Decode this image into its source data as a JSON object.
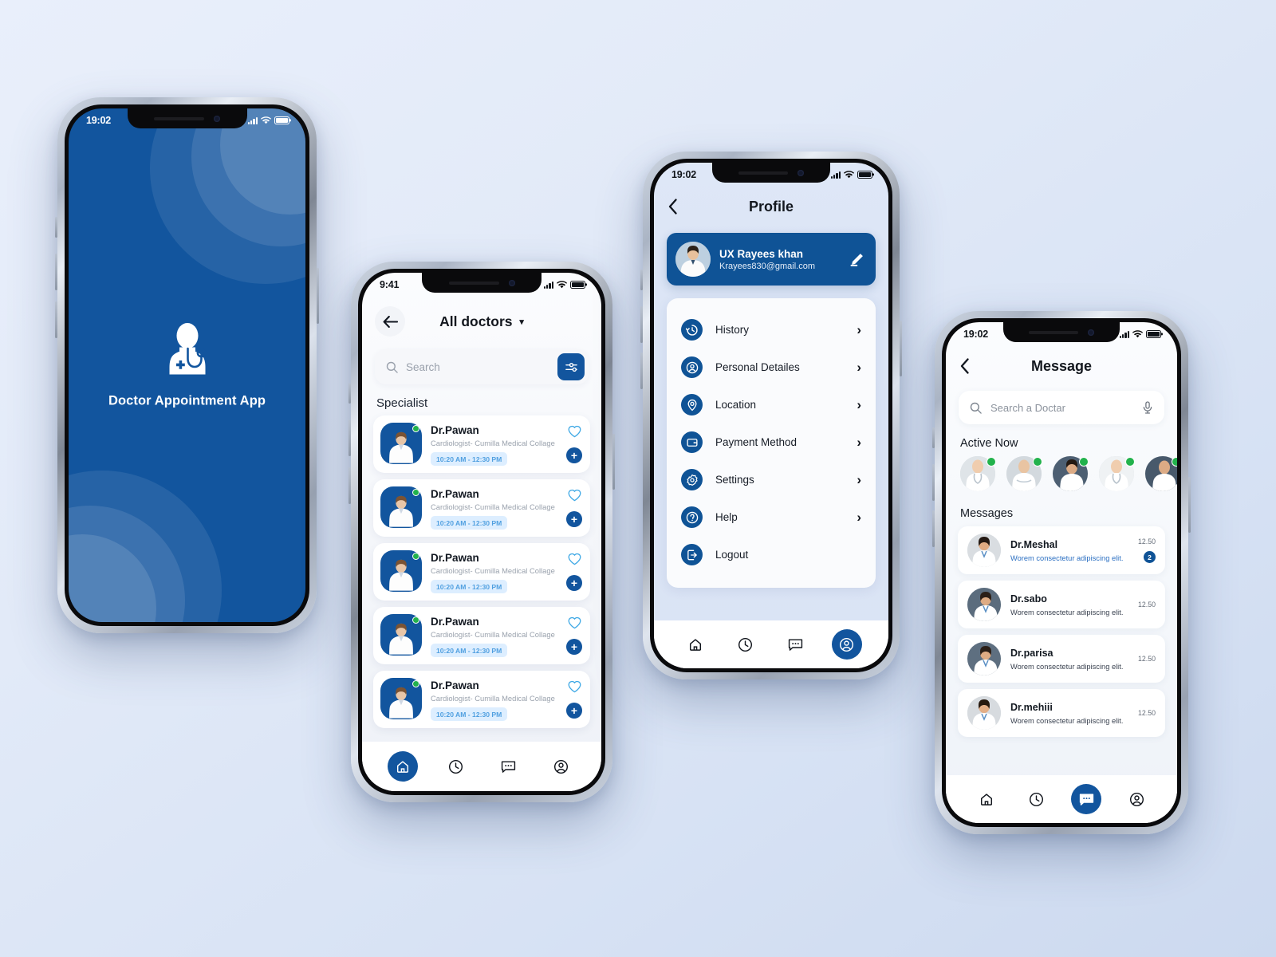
{
  "theme": {
    "primary": "#12559e",
    "primary_dark": "#0f5396",
    "accent_chip_bg": "#ddeeff",
    "accent_chip_text": "#4f9fe0",
    "online": "#22b24c",
    "page_bg": "#e2eaf8"
  },
  "splash": {
    "status": {
      "time": "19:02"
    },
    "icon": "doctor-icon",
    "title": "Doctor Appointment App"
  },
  "doctors": {
    "status": {
      "time": "9:41"
    },
    "back_icon": "arrow-left-icon",
    "title": "All doctors",
    "dropdown_caret": "▾",
    "search": {
      "placeholder": "Search",
      "icon": "search-icon"
    },
    "filter_icon": "filter-icon",
    "section_title": "Specialist",
    "list": [
      {
        "name": "Dr.Pawan",
        "specialty": "Cardiologist- Cumilla Medical Collage",
        "time": "10:20 AM - 12:30 PM",
        "online": true,
        "favorite": false
      },
      {
        "name": "Dr.Pawan",
        "specialty": "Cardiologist- Cumilla Medical Collage",
        "time": "10:20 AM - 12:30 PM",
        "online": true,
        "favorite": false
      },
      {
        "name": "Dr.Pawan",
        "specialty": "Cardiologist- Cumilla Medical Collage",
        "time": "10:20 AM - 12:30 PM",
        "online": true,
        "favorite": false
      },
      {
        "name": "Dr.Pawan",
        "specialty": "Cardiologist- Cumilla Medical Collage",
        "time": "10:20 AM - 12:30 PM",
        "online": true,
        "favorite": false
      },
      {
        "name": "Dr.Pawan",
        "specialty": "Cardiologist- Cumilla Medical Collage",
        "time": "10:20 AM - 12:30 PM",
        "online": true,
        "favorite": false
      }
    ],
    "add_label": "+",
    "nav": [
      {
        "icon": "home-icon",
        "active": true
      },
      {
        "icon": "clock-icon",
        "active": false
      },
      {
        "icon": "chat-icon",
        "active": false
      },
      {
        "icon": "person-icon",
        "active": false
      }
    ]
  },
  "profile": {
    "status": {
      "time": "19:02"
    },
    "back_icon": "chevron-left-icon",
    "title": "Profile",
    "user": {
      "name": "UX Rayees khan",
      "email": "Krayees830@gmail.com",
      "avatar": "user-avatar",
      "edit_icon": "pencil-icon"
    },
    "menu": [
      {
        "label": "History",
        "icon": "history-icon",
        "chevron": true
      },
      {
        "label": "Personal Detailes",
        "icon": "person-circle-icon",
        "chevron": true
      },
      {
        "label": "Location",
        "icon": "location-pin-icon",
        "chevron": true
      },
      {
        "label": "Payment Method",
        "icon": "wallet-icon",
        "chevron": true
      },
      {
        "label": "Settings",
        "icon": "gear-icon",
        "chevron": true
      },
      {
        "label": "Help",
        "icon": "question-icon",
        "chevron": true
      },
      {
        "label": "Logout",
        "icon": "logout-icon",
        "chevron": false
      }
    ],
    "chevron": "›",
    "nav": [
      {
        "icon": "home-icon",
        "active": false
      },
      {
        "icon": "clock-icon",
        "active": false
      },
      {
        "icon": "chat-icon",
        "active": false
      },
      {
        "icon": "person-icon",
        "active": true
      }
    ]
  },
  "message": {
    "status": {
      "time": "19:02"
    },
    "back_icon": "chevron-left-icon",
    "title": "Message",
    "search": {
      "placeholder": "Search a Doctar",
      "icon": "search-icon",
      "mic_icon": "mic-icon"
    },
    "active_title": "Active Now",
    "active_now": [
      {
        "online": true
      },
      {
        "online": true
      },
      {
        "online": true
      },
      {
        "online": true
      },
      {
        "online": true
      }
    ],
    "messages_title": "Messages",
    "messages": [
      {
        "name": "Dr.Meshal",
        "preview": "Worem consectetur adipiscing elit.",
        "time": "12.50",
        "unread": true,
        "badge": "2"
      },
      {
        "name": "Dr.sabo",
        "preview": "Worem consectetur adipiscing elit.",
        "time": "12.50",
        "unread": false,
        "badge": ""
      },
      {
        "name": "Dr.parisa",
        "preview": "Worem consectetur adipiscing elit.",
        "time": "12.50",
        "unread": false,
        "badge": ""
      },
      {
        "name": "Dr.mehiii",
        "preview": "Worem consectetur adipiscing elit.",
        "time": "12.50",
        "unread": false,
        "badge": ""
      }
    ],
    "nav": [
      {
        "icon": "home-icon",
        "active": false
      },
      {
        "icon": "clock-icon",
        "active": false
      },
      {
        "icon": "chat-icon",
        "active": true
      },
      {
        "icon": "person-icon",
        "active": false
      }
    ]
  }
}
